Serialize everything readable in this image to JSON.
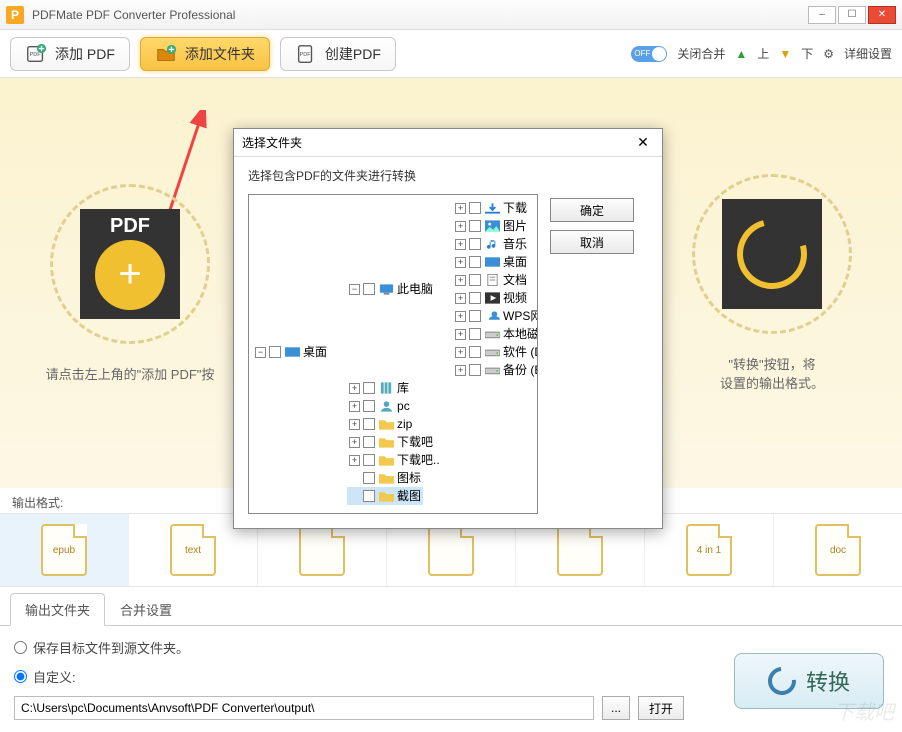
{
  "window": {
    "title": "PDFMate PDF Converter Professional"
  },
  "toolbar": {
    "add_pdf": "添加 PDF",
    "add_folder": "添加文件夹",
    "create_pdf": "创建PDF",
    "toggle_state": "OFF",
    "close_merge": "关闭合并",
    "move_up": "上",
    "move_down": "下",
    "advanced": "详细设置"
  },
  "main": {
    "left_hint": "请点击左上角的\"添加 PDF\"按",
    "right_hint_line1": "\"转换\"按钮，将",
    "right_hint_line2": "设置的输出格式。",
    "pdf_label": "PDF"
  },
  "formats": {
    "label": "输出格式:",
    "items": [
      "epub",
      "text",
      "",
      "",
      "",
      "4 in 1",
      "doc"
    ]
  },
  "tabs": {
    "output_folder": "输出文件夹",
    "merge_settings": "合并设置"
  },
  "panel": {
    "radio_source": "保存目标文件到源文件夹。",
    "radio_custom": "自定义:",
    "path": "C:\\Users\\pc\\Documents\\Anvsoft\\PDF Converter\\output\\",
    "browse": "...",
    "open": "打开"
  },
  "convert": "转换",
  "dialog": {
    "title": "选择文件夹",
    "desc": "选择包含PDF的文件夹进行转换",
    "ok": "确定",
    "cancel": "取消",
    "tree": {
      "desktop": "桌面",
      "this_pc": "此电脑",
      "downloads": "下载",
      "pictures": "图片",
      "music": "音乐",
      "desk": "桌面",
      "documents": "文档",
      "videos": "视频",
      "wps": "WPS网盘",
      "localc": "本地磁盘 (C:)",
      "softd": "软件 (D:)",
      "backupe": "备份 (E:)",
      "library": "库",
      "pc": "pc",
      "zip": "zip",
      "xiazaiba": "下载吧",
      "xiazaiba2": "下载吧..",
      "tubiao": "图标",
      "jietu": "截图"
    }
  },
  "watermark": "下载吧"
}
